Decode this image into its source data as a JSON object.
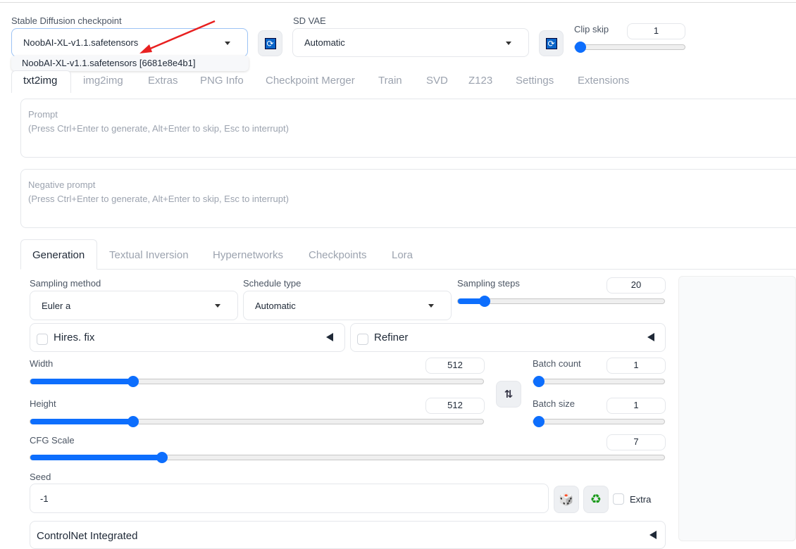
{
  "checkpoint": {
    "label": "Stable Diffusion checkpoint",
    "value": "NoobAI-XL-v1.1.safetensors",
    "option": "NoobAI-XL-v1.1.safetensors [6681e8e4b1]"
  },
  "vae": {
    "label": "SD VAE",
    "value": "Automatic"
  },
  "clip_skip": {
    "label": "Clip skip",
    "value": "1",
    "min": 1,
    "max": 12
  },
  "main_tabs": [
    "txt2img",
    "img2img",
    "Extras",
    "PNG Info",
    "Checkpoint Merger",
    "Train",
    "SVD",
    "Z123",
    "Settings",
    "Extensions"
  ],
  "prompt": {
    "label": "Prompt",
    "placeholder": "(Press Ctrl+Enter to generate, Alt+Enter to skip, Esc to interrupt)"
  },
  "negative": {
    "label": "Negative prompt",
    "placeholder": "(Press Ctrl+Enter to generate, Alt+Enter to skip, Esc to interrupt)"
  },
  "sub_tabs": [
    "Generation",
    "Textual Inversion",
    "Hypernetworks",
    "Checkpoints",
    "Lora"
  ],
  "sampling_method": {
    "label": "Sampling method",
    "value": "Euler a"
  },
  "schedule_type": {
    "label": "Schedule type",
    "value": "Automatic"
  },
  "sampling_steps": {
    "label": "Sampling steps",
    "value": "20",
    "min": 1,
    "max": 150
  },
  "hires": {
    "label": "Hires. fix"
  },
  "refiner": {
    "label": "Refiner"
  },
  "width": {
    "label": "Width",
    "value": "512",
    "min": 64,
    "max": 2048
  },
  "height": {
    "label": "Height",
    "value": "512",
    "min": 64,
    "max": 2048
  },
  "batch_count": {
    "label": "Batch count",
    "value": "1",
    "min": 1,
    "max": 100
  },
  "batch_size": {
    "label": "Batch size",
    "value": "1",
    "min": 1,
    "max": 8
  },
  "cfg": {
    "label": "CFG Scale",
    "value": "7",
    "min": 1,
    "max": 30
  },
  "seed": {
    "label": "Seed",
    "value": "-1",
    "extra": "Extra"
  },
  "controlnet": {
    "label": "ControlNet Integrated"
  },
  "colors": {
    "accent": "#0d6efd",
    "arrow": "#e82020"
  }
}
